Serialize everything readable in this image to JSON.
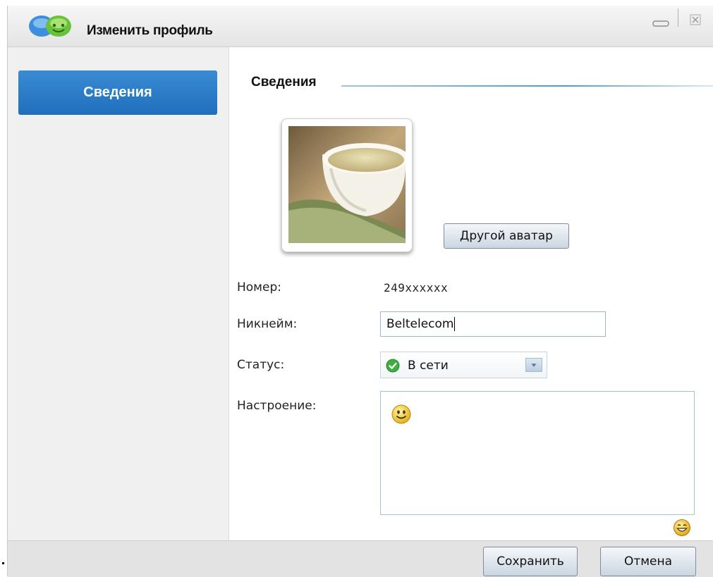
{
  "window": {
    "title": "Изменить профиль",
    "icons": {
      "logo": "chat-bubbles-logo-icon",
      "minimize": "minimize-icon",
      "close": "close-icon"
    }
  },
  "sidebar": {
    "items": [
      {
        "label": "Сведения",
        "active": true
      }
    ]
  },
  "section": {
    "title": "Сведения"
  },
  "avatar": {
    "change_button": "Другой аватар",
    "image": "tea-cup-photo"
  },
  "fields": {
    "number": {
      "label": "Номер:",
      "value": "249xxxxxx"
    },
    "nickname": {
      "label": "Никнейм:",
      "value": "Beltelecom"
    },
    "status": {
      "label": "Статус:",
      "value": "В сети",
      "icon": "online-check-icon"
    },
    "mood": {
      "label": "Настроение:",
      "value": "",
      "icon": "smiley-icon"
    }
  },
  "emoji_button_icon": "emoji-picker-icon",
  "footer": {
    "save": "Сохранить",
    "cancel": "Отмена"
  },
  "colors": {
    "accent": "#1f6fbc",
    "online": "#3fae3f",
    "button_border": "#7f8c99"
  }
}
